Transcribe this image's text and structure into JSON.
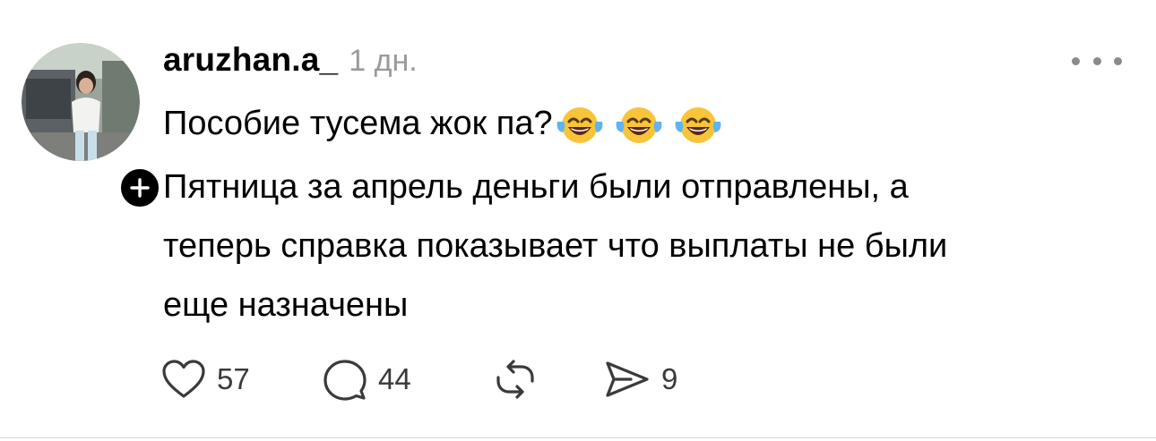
{
  "post": {
    "username": "aruzhan.a_",
    "timestamp": "1 дн.",
    "text_line1": "Пособие тусема жок па?",
    "text_emoji": [
      "😂",
      "😂",
      "😂"
    ],
    "text_line2": "Пятница за апрель деньги были отправлены, а",
    "text_line3": "теперь справка показывает что выплаты не были",
    "text_line4": "еще назначены"
  },
  "actions": {
    "likes": "57",
    "replies": "44",
    "shares": "9"
  },
  "icons": [
    "profile-avatar",
    "plus-icon",
    "more-icon",
    "heart-icon",
    "comment-icon",
    "repost-icon",
    "send-icon",
    "laughing-tears-emoji"
  ],
  "colors": {
    "text": "#000000",
    "muted": "#9a9a9a",
    "icon": "#3a3a3a",
    "emoji_face": "#f7c43a"
  }
}
